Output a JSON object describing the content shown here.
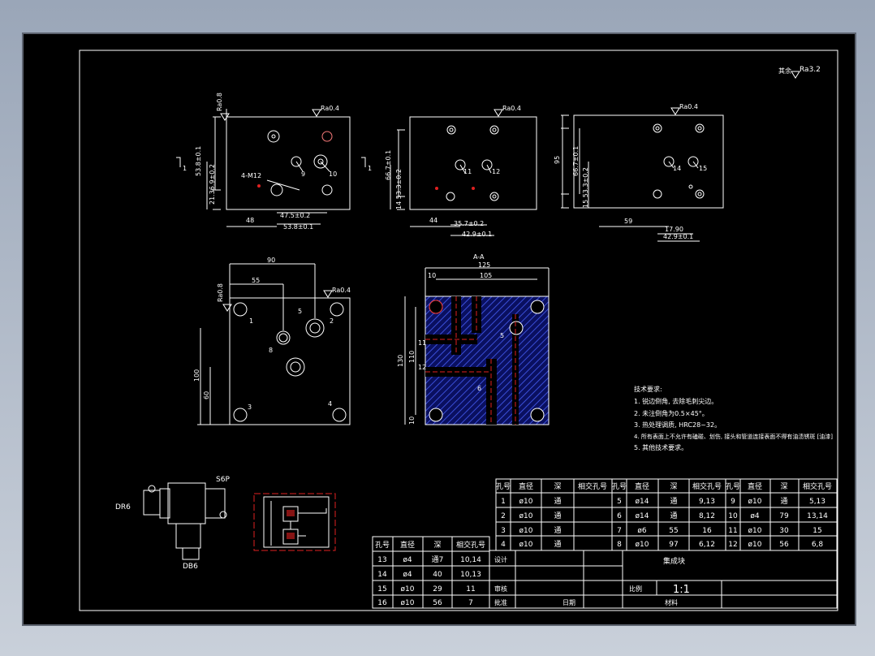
{
  "roughness": {
    "global": "Ra3.2",
    "r04": "Ra0.4",
    "r08": "Ra0.8",
    "other_prefix": "其余"
  },
  "view1": {
    "ref": "1",
    "dims": {
      "d1": "53.8±0.1",
      "d2": "21.36.9±0.2",
      "d3": "48",
      "d4": "47.5±0.2",
      "d5": "53.8±0.1"
    },
    "thread": "4-M12",
    "labels": [
      "9",
      "10"
    ]
  },
  "view2": {
    "ref": "1",
    "dims": {
      "d1": "66.7±0.1",
      "d2": "14 53.3±0.2",
      "d3": "44",
      "d4": "35.7±0.2",
      "d5": "42.9±0.1"
    },
    "labels": [
      "11",
      "12"
    ]
  },
  "view3": {
    "dims": {
      "d1": "95",
      "d2": "66.7±0.1",
      "d3": "15 53.3±0.2",
      "d4": "59",
      "d5": "17.90",
      "d6": "42.9±0.1"
    },
    "labels": [
      "14",
      "15"
    ]
  },
  "view4": {
    "dims": {
      "d1": "90",
      "d2": "55",
      "d3": "100",
      "d4": "60"
    },
    "labels": [
      "1",
      "2",
      "3",
      "4",
      "5",
      "8"
    ]
  },
  "section": {
    "title": "A-A",
    "dims": {
      "d1": "125",
      "d2": "10",
      "d3": "105",
      "d4": "130",
      "d5": "110",
      "d6": "10"
    },
    "labels": [
      "11",
      "12",
      "5",
      "6"
    ]
  },
  "valves": {
    "dr6": "DR6",
    "s6p": "S6P",
    "db6": "DB6"
  },
  "notes": {
    "title": "技术要求:",
    "lines": [
      "1. 锐边倒角, 去除毛刺尖边。",
      "2. 未注倒角为0.5×45°。",
      "3. 热处理调质, HRC28~32。",
      "4. 所有表面上不允许有磕碰、划伤, 接头和管道连接表面不得有油渍锈斑 [油漆]",
      "5. 其他技术要求。"
    ]
  },
  "hole_table": {
    "headers": [
      "孔号",
      "直径",
      "深",
      "相交孔号",
      "孔号",
      "直径",
      "深",
      "相交孔号",
      "孔号",
      "直径",
      "深",
      "相交孔号"
    ],
    "rows": [
      [
        "1",
        "ø10",
        "通",
        "",
        "5",
        "ø14",
        "通",
        "9,13",
        "9",
        "ø10",
        "通",
        "5,13"
      ],
      [
        "2",
        "ø10",
        "通",
        "",
        "6",
        "ø14",
        "通",
        "8,12",
        "10",
        "ø4",
        "79",
        "13,14"
      ],
      [
        "3",
        "ø10",
        "通",
        "",
        "7",
        "ø6",
        "55",
        "16",
        "11",
        "ø10",
        "30",
        "15"
      ],
      [
        "4",
        "ø10",
        "通",
        "",
        "8",
        "ø10",
        "97",
        "6,12",
        "12",
        "ø10",
        "56",
        "6,8"
      ]
    ]
  },
  "hole_table2": {
    "headers": [
      "孔号",
      "直径",
      "深",
      "相交孔号"
    ],
    "rows": [
      [
        "13",
        "ø4",
        "通7",
        "10,14"
      ],
      [
        "14",
        "ø4",
        "40",
        "10,13"
      ],
      [
        "15",
        "ø10",
        "29",
        "11"
      ],
      [
        "16",
        "ø10",
        "56",
        "7"
      ]
    ]
  },
  "title_block": {
    "name": "集成块",
    "scale_label": "比例",
    "scale": "1:1",
    "material_label": "材料",
    "designer": "设计",
    "checker": "审核",
    "approver": "批准",
    "date_label": "日期"
  }
}
